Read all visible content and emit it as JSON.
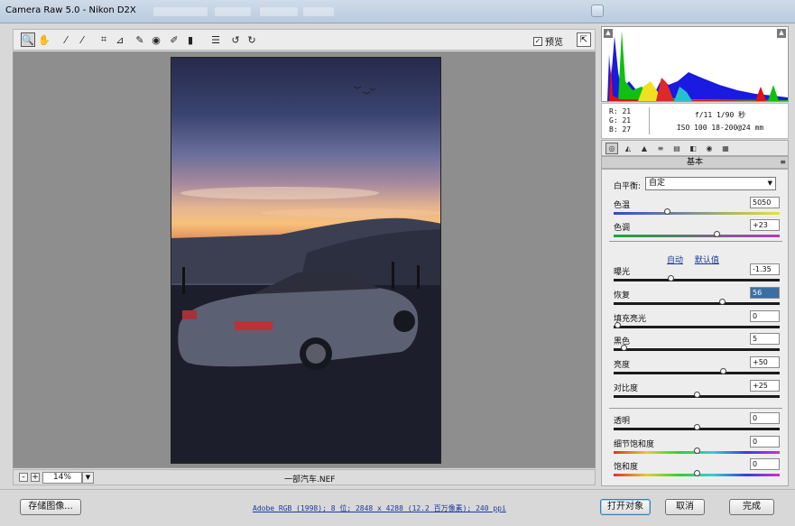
{
  "window": {
    "title": "Camera Raw 5.0 -  Nikon D2X"
  },
  "toolbar": {
    "tools": [
      {
        "name": "zoom-tool",
        "icon": "magnifier-icon",
        "glyph": "🔍"
      },
      {
        "name": "hand-tool",
        "icon": "hand-icon",
        "glyph": "✋"
      },
      {
        "name": "white-balance-tool",
        "icon": "eyedropper-icon",
        "glyph": "⁄"
      },
      {
        "name": "color-sampler-tool",
        "icon": "eyedropper-plus-icon",
        "glyph": "⁄"
      },
      {
        "name": "crop-tool",
        "icon": "crop-icon",
        "glyph": "⌗"
      },
      {
        "name": "straighten-tool",
        "icon": "straighten-icon",
        "glyph": "⊿"
      },
      {
        "name": "spot-removal-tool",
        "icon": "brush-icon",
        "glyph": "✎"
      },
      {
        "name": "red-eye-tool",
        "icon": "eye-icon",
        "glyph": "◉"
      },
      {
        "name": "adjustment-brush-tool",
        "icon": "brush-icon",
        "glyph": "✐"
      },
      {
        "name": "graduated-filter-tool",
        "icon": "gradient-icon",
        "glyph": "▮"
      },
      {
        "name": "preferences-tool",
        "icon": "list-icon",
        "glyph": "☰"
      },
      {
        "name": "rotate-left-tool",
        "icon": "rotate-ccw-icon",
        "glyph": "↺"
      },
      {
        "name": "rotate-right-tool",
        "icon": "rotate-cw-icon",
        "glyph": "↻"
      }
    ],
    "preview_label": "预览",
    "preview_checked": "✓",
    "fullscreen_glyph": "⇱"
  },
  "histogram": {
    "shadow_clip_glyph": "▲",
    "highlight_clip_glyph": "▲",
    "rgb_lines": [
      "R:   21",
      "G:   21",
      "B:   27"
    ],
    "exif_line1": "f/11  1/90 秒",
    "exif_line2": "ISO 100  18-200@24 mm"
  },
  "panel": {
    "tabs": [
      "◎",
      "◭",
      "▲",
      "≡",
      "▤",
      "◧",
      "◉",
      "▦"
    ],
    "title": "基本",
    "menu_glyph": "≡",
    "white_balance_label": "白平衡:",
    "white_balance_value": "自定",
    "auto_link": "自动",
    "default_link": "默认值",
    "sliders": [
      {
        "label": "色温",
        "value": "5050",
        "pos": 0.32,
        "track": "temp"
      },
      {
        "label": "色调",
        "value": "+23",
        "pos": 0.62,
        "track": "tint"
      },
      {
        "label": "曝光",
        "value": "-1.35",
        "pos": 0.34,
        "track": "plain"
      },
      {
        "label": "恢复",
        "value": "56",
        "pos": 0.65,
        "track": "plain",
        "selected": true
      },
      {
        "label": "填充亮光",
        "value": "0",
        "pos": 0.02,
        "track": "plain"
      },
      {
        "label": "黑色",
        "value": "5",
        "pos": 0.06,
        "track": "plain"
      },
      {
        "label": "亮度",
        "value": "+50",
        "pos": 0.66,
        "track": "plain"
      },
      {
        "label": "对比度",
        "value": "+25",
        "pos": 0.5,
        "track": "plain"
      },
      {
        "label": "透明",
        "value": "0",
        "pos": 0.5,
        "track": "plain"
      },
      {
        "label": "细节饱和度",
        "value": "0",
        "pos": 0.5,
        "track": "sat"
      },
      {
        "label": "饱和度",
        "value": "0",
        "pos": 0.5,
        "track": "sat"
      }
    ]
  },
  "statusbar": {
    "zoom_minus": "-",
    "zoom_plus": "+",
    "zoom_value": "14%",
    "zoom_dropdown": "▼",
    "filename": "一部汽车.NEF"
  },
  "bottombar": {
    "save_label": "存储图像...",
    "workflow_link": "Adobe RGB (1998); 8 位; 2848 x 4288 (12.2 百万像素); 240 ppi",
    "open_label": "打开对象",
    "cancel_label": "取消",
    "done_label": "完成"
  }
}
